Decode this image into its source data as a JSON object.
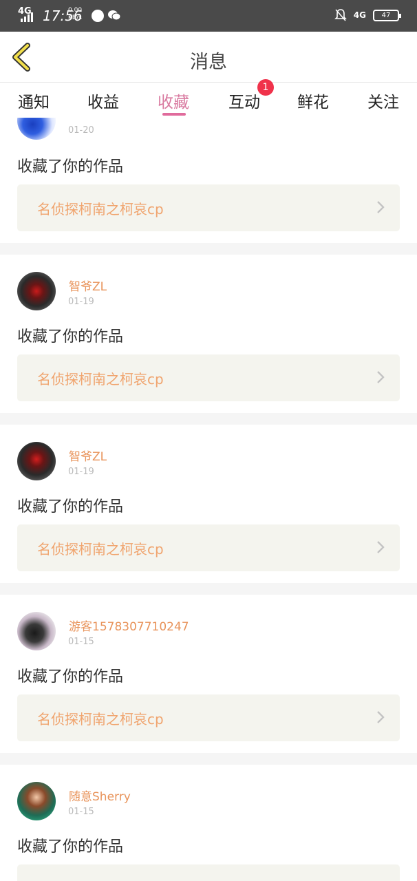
{
  "status_bar": {
    "network": "4G",
    "time": "17:56",
    "speed_value": "0.00",
    "speed_unit": "KB/s",
    "right_network": "4G",
    "battery": "47"
  },
  "header": {
    "title": "消息",
    "back_icon": "chevron-left-icon"
  },
  "tabs": [
    {
      "label": "通知",
      "active": false
    },
    {
      "label": "收益",
      "active": false
    },
    {
      "label": "收藏",
      "active": true
    },
    {
      "label": "互动",
      "active": false,
      "badge": "1"
    },
    {
      "label": "鲜花",
      "active": false
    },
    {
      "label": "关注",
      "active": false
    }
  ],
  "colors": {
    "accent": "#e06b9c",
    "username": "#e8935a",
    "work_title": "#f0a46e",
    "badge": "#f0324b"
  },
  "feed": [
    {
      "username": "",
      "time": "01-20",
      "action": "收藏了你的作品",
      "work_title": "名侦探柯南之柯哀cp"
    },
    {
      "username": "智爷ZL",
      "time": "01-19",
      "action": "收藏了你的作品",
      "work_title": "名侦探柯南之柯哀cp"
    },
    {
      "username": "智爷ZL",
      "time": "01-19",
      "action": "收藏了你的作品",
      "work_title": "名侦探柯南之柯哀cp"
    },
    {
      "username": "游客1578307710247",
      "time": "01-15",
      "action": "收藏了你的作品",
      "work_title": "名侦探柯南之柯哀cp"
    },
    {
      "username": "随意Sherry",
      "time": "01-15",
      "action": "收藏了你的作品",
      "work_title": ""
    }
  ]
}
